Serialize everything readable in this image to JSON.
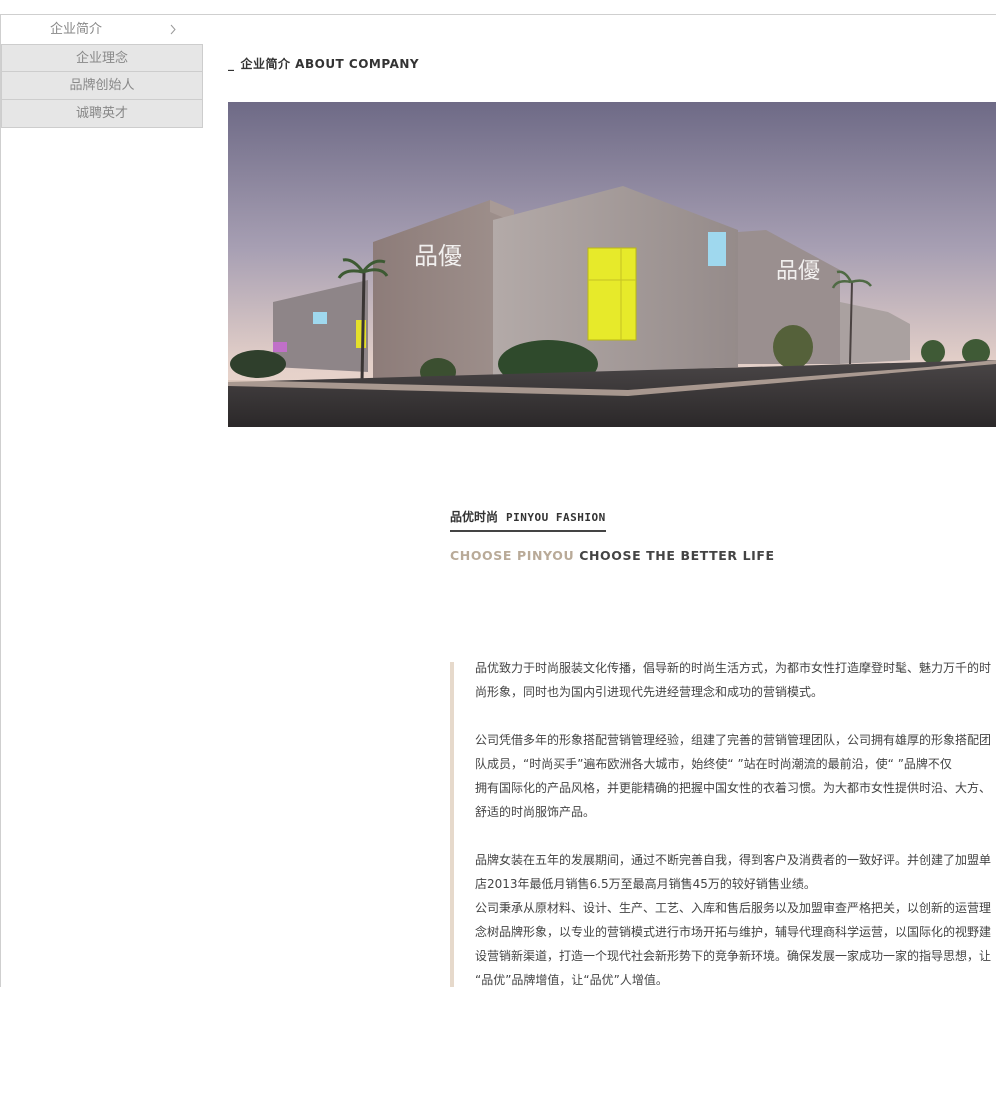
{
  "sidebar": {
    "items": [
      {
        "label": "企业简介",
        "active": true
      },
      {
        "label": "企业理念",
        "active": false
      },
      {
        "label": "品牌创始人",
        "active": false
      },
      {
        "label": "诚聘英才",
        "active": false
      }
    ]
  },
  "section": {
    "dash": "_",
    "title": "企业简介 ABOUT COMPANY"
  },
  "photo": {
    "alt": "company building",
    "sign_left": "品優",
    "sign_right": "品優"
  },
  "brand": {
    "title_cn": "品优时尚",
    "title_en": "PINYOU FASHION",
    "slogan_a": "CHOOSE PINYOU",
    "slogan_b": "CHOOSE THE BETTER LIFE"
  },
  "body": {
    "lines": [
      "品优致力于时尚服装文化传播，倡导新的时尚生活方式，为都市女性打造摩登时髦、魅力万千的时",
      "尚形象，同时也为国内引进现代先进经营理念和成功的营销模式。",
      "",
      "公司凭借多年的形象搭配营销管理经验，组建了完善的营销管理团队，公司拥有雄厚的形象搭配团",
      "队成员，“时尚买手”遍布欧洲各大城市，始终使“ ”站在时尚潮流的最前沿，使“ ”品牌不仅",
      "拥有国际化的产品风格，并更能精确的把握中国女性的衣着习惯。为大都市女性提供时沿、大方、",
      "舒适的时尚服饰产品。",
      "",
      "品牌女装在五年的发展期间，通过不断完善自我，得到客户及消费者的一致好评。并创建了加盟单",
      "店2013年最低月销售6.5万至最高月销售45万的较好销售业绩。",
      "公司秉承从原材料、设计、生产、工艺、入库和售后服务以及加盟审查严格把关，以创新的运营理",
      "念树品牌形象，以专业的营销模式进行市场开拓与维护，辅导代理商科学运营，以国际化的视野建",
      "设营销新渠道，打造一个现代社会新形势下的竞争新环境。确保发展一家成功一家的指导思想，让",
      "“品优”品牌增值，让“品优”人增值。"
    ]
  }
}
